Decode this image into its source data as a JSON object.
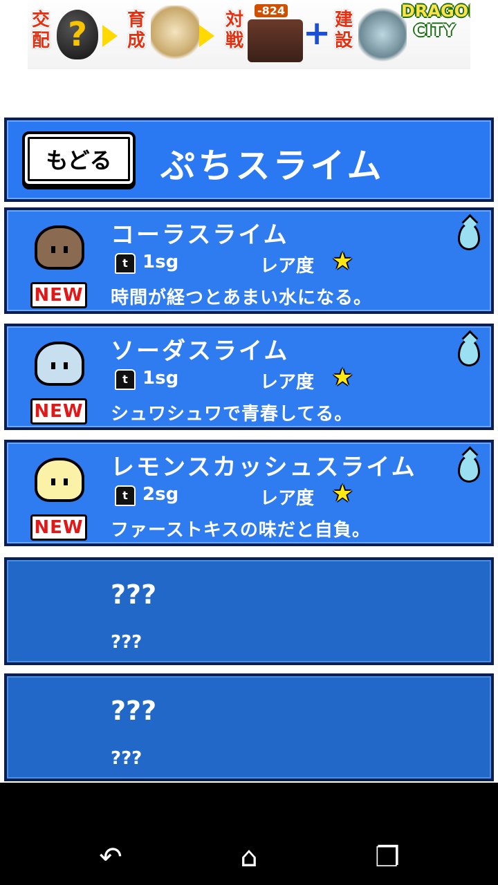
{
  "ad": {
    "step1": "交配",
    "step2": "育成",
    "step3": "対戦",
    "step4": "建設",
    "score": "-824",
    "logo_top": "DRAGON",
    "logo_bottom": "CITY",
    "question_mark": "?",
    "plus": "+"
  },
  "header": {
    "back_label": "もどる",
    "title": "ぷちスライム"
  },
  "items": [
    {
      "name": "コーラスライム",
      "weight": "1sg",
      "rarity_label": "レア度",
      "badge": "NEW",
      "desc": "時間が経つとあまい水になる。",
      "slime_color": "#8a6a50"
    },
    {
      "name": "ソーダスライム",
      "weight": "1sg",
      "rarity_label": "レア度",
      "badge": "NEW",
      "desc": "シュワシュワで青春してる。",
      "slime_color": "#c8dff0"
    },
    {
      "name": "レモンスカッシュスライム",
      "weight": "2sg",
      "rarity_label": "レア度",
      "badge": "NEW",
      "desc": "ファーストキスの味だと自負。",
      "slime_color": "#fbf2a8"
    }
  ],
  "locked_items": [
    {
      "name": "???",
      "desc": "???"
    },
    {
      "name": "???",
      "desc": "???"
    }
  ],
  "weight_icon_text": "t",
  "star_glyph": "★",
  "colors": {
    "panel_blue": "#2f7bf0",
    "locked_blue": "#2168c8",
    "border": "#0a1e54",
    "new_red": "#e01818",
    "star_yellow": "#ffe814",
    "drop": "#9be0f2"
  },
  "navbar": {
    "back_icon": "↶",
    "home_icon": "⌂",
    "recent_icon": "❐"
  }
}
